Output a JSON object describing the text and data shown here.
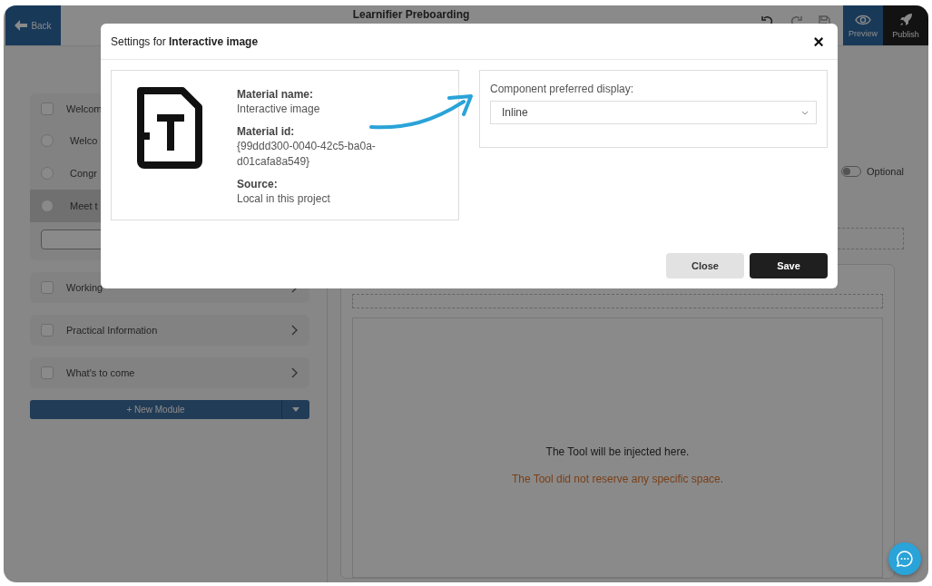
{
  "topbar": {
    "back": "Back",
    "title": "Learnifier Preboarding",
    "actions": [
      {
        "label": "Preview",
        "kind": "preview"
      },
      {
        "label": "Publish",
        "kind": "publish"
      }
    ]
  },
  "sidebar": {
    "modules": [
      {
        "title": "Welcom",
        "checked": false,
        "children": [
          {
            "title": "Welco",
            "selected": false
          },
          {
            "title": "Congr",
            "selected": false
          },
          {
            "title": "Meet t",
            "selected": true
          }
        ]
      },
      {
        "title": "Working",
        "checked": false
      },
      {
        "title": "Practical Information",
        "checked": false
      },
      {
        "title": "What's to come",
        "checked": false
      }
    ],
    "new_module": "+ New Module"
  },
  "content": {
    "optional": {
      "label": "Optional",
      "on": false
    },
    "tool_message": "The Tool will be injected here.",
    "tool_warning": "The Tool did not reserve any specific space."
  },
  "dialog": {
    "title": "Settings for **Interactive image**",
    "close": "×",
    "details": [
      {
        "label": "Material name:",
        "value": "Interactive image"
      },
      {
        "label": "Material id:",
        "value": "{99ddd300-0040-42c5-ba0a-d01cafa8a549}"
      },
      {
        "label": "Source:",
        "value": "Local in this project"
      }
    ],
    "display": {
      "label": "Component preferred display:",
      "value": "Inline"
    },
    "buttons": [
      {
        "label": "Close",
        "kind": "secondary"
      },
      {
        "label": "Save",
        "kind": "primary"
      }
    ]
  }
}
